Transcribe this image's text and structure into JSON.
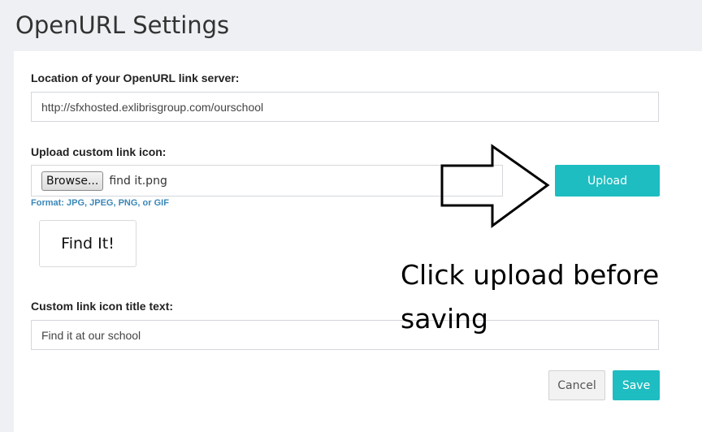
{
  "page": {
    "title": "OpenURL Settings"
  },
  "form": {
    "link_server": {
      "label": "Location of your OpenURL link server:",
      "value": "http://sfxhosted.exlibrisgroup.com/ourschool"
    },
    "link_icon": {
      "label": "Upload custom link icon:",
      "browse_label": "Browse...",
      "file_name": "find it.png",
      "format_hint": "Format: JPG, JPEG, PNG, or GIF",
      "preview_text": "Find It!",
      "upload_label": "Upload"
    },
    "title_text": {
      "label": "Custom link icon title text:",
      "value": "Find it at our school"
    },
    "actions": {
      "cancel_label": "Cancel",
      "save_label": "Save"
    }
  },
  "annotation": {
    "text": "Click upload before saving",
    "arrow_icon": "right-arrow-outline-icon"
  },
  "colors": {
    "accent": "#1ebdc1",
    "hint": "#3a87b8",
    "background": "#eef0f3"
  }
}
